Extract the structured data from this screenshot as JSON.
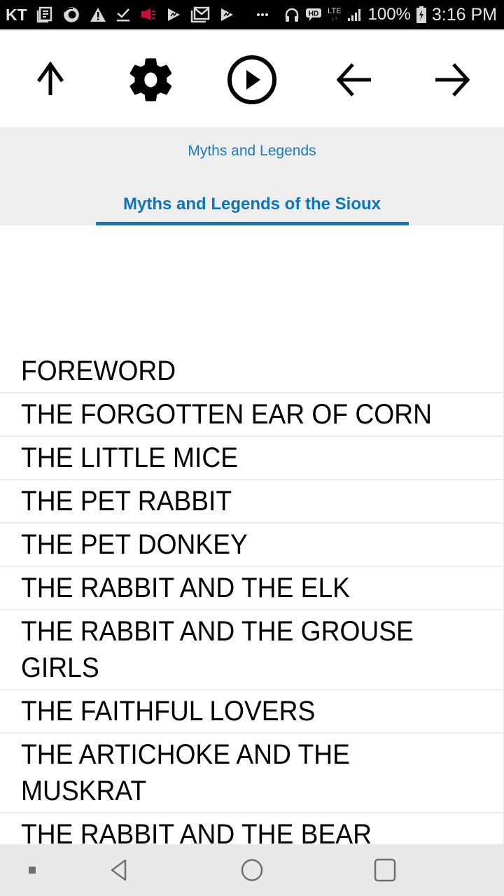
{
  "status_bar": {
    "left_icons": [
      "kt-carrier-icon",
      "news-icon",
      "firefox-icon",
      "warning-icon",
      "download-done-icon",
      "megaphone-icon",
      "play-store-icon",
      "mail-icon",
      "play-store-icon",
      "more-dots-icon"
    ],
    "carrier": "KT",
    "right_icons": [
      "headphones-icon",
      "hd-voice-icon",
      "lte-icon",
      "signal-icon",
      "battery-charging-icon"
    ],
    "lte_label": "LTE",
    "battery": "100%",
    "time": "3:16 PM",
    "megaphone_color": "#c0143c"
  },
  "toolbar": {
    "buttons": [
      {
        "name": "up",
        "icon": "arrow-up-icon"
      },
      {
        "name": "settings",
        "icon": "gear-icon"
      },
      {
        "name": "play",
        "icon": "play-circle-icon"
      },
      {
        "name": "back",
        "icon": "arrow-left-icon"
      },
      {
        "name": "forward",
        "icon": "arrow-right-icon"
      }
    ]
  },
  "header": {
    "breadcrumb": "Myths and Legends",
    "book_title": "Myths and Legends of the Sioux",
    "accent_color": "#0f75b8"
  },
  "chapters": [
    "FOREWORD",
    "THE FORGOTTEN EAR OF CORN",
    "THE LITTLE MICE",
    "THE PET RABBIT",
    "THE PET DONKEY",
    "THE RABBIT AND THE ELK",
    "THE RABBIT AND THE GROUSE GIRLS",
    "THE FAITHFUL LOVERS",
    "THE ARTICHOKE AND THE MUSKRAT",
    "THE RABBIT AND THE BEAR"
  ],
  "nav_bar": {
    "buttons": [
      "recent-apps-dot-icon",
      "back-icon",
      "home-icon",
      "overview-icon"
    ]
  }
}
